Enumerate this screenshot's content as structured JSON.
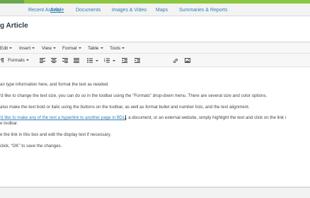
{
  "nav": {
    "tabs": [
      {
        "label": "Recent Activity"
      },
      {
        "label": "Article"
      },
      {
        "label": "Documents"
      },
      {
        "label": "Images & Video"
      },
      {
        "label": "Maps"
      },
      {
        "label": "Summaries & Reports"
      }
    ],
    "active_tab": "Article"
  },
  "page": {
    "title": "g Article"
  },
  "editor": {
    "menus": [
      {
        "label": "Edit"
      },
      {
        "label": "Insert"
      },
      {
        "label": "View"
      },
      {
        "label": "Format"
      },
      {
        "label": "Table"
      },
      {
        "label": "Tools"
      }
    ],
    "toolbar": {
      "formats_label": "Formats",
      "icons": [
        "paragraph-icon",
        "align-left-icon",
        "align-center-icon",
        "align-right-icon",
        "align-justify-icon",
        "bullet-list-icon",
        "numbered-list-icon",
        "outdent-icon",
        "indent-icon",
        "link-icon",
        "image-icon"
      ]
    },
    "paragraphs": [
      {
        "text": "an type information here, and format the text as needed."
      },
      {
        "text": "'d like to change the text size, you can do so in the toolbar using the “Formats” drop-down menu. There are several size and color options."
      },
      {
        "text": "also make the text bold or italic using the buttons on the toolbar, as well as format bullet and number lists, and the text alignment."
      },
      {
        "link_text": "'d like to make any of the text a hyperlink to another page in BDL",
        "after_text": ", a document, or an external website, simply highlight the text and click on the link i",
        "line2": "e toolbar."
      },
      {
        "text": "e the link in this box and edit the display text if necessary."
      },
      {
        "text": " click, “OK” to save the changes."
      }
    ]
  },
  "colors": {
    "accent_green": "#8dc63f",
    "link_blue": "#2e7fb6",
    "title": "#2b3b49"
  }
}
